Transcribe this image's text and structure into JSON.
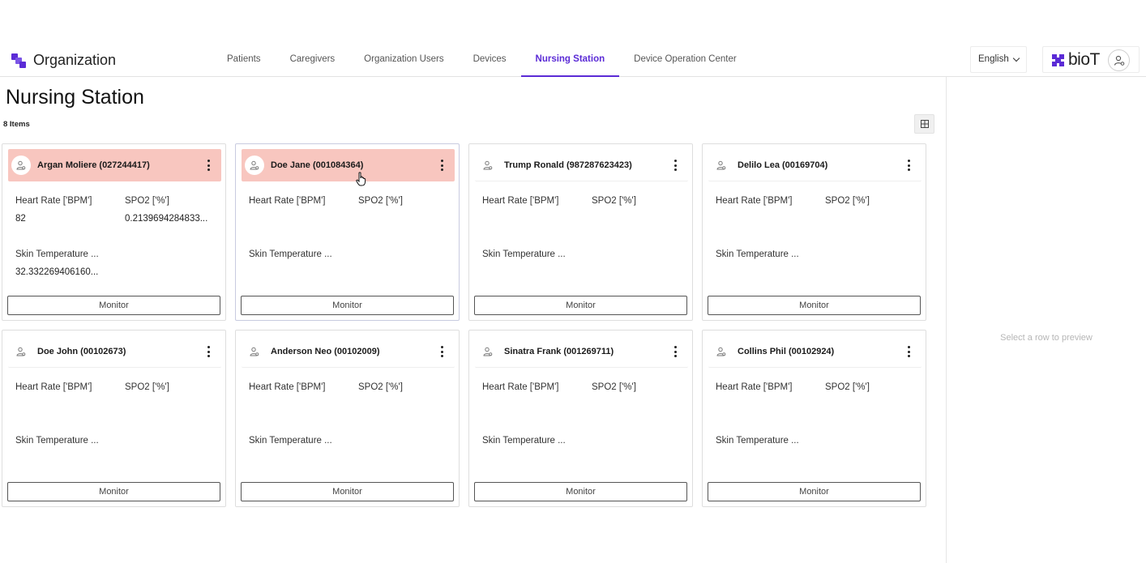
{
  "app": {
    "title": "Organization",
    "brand": "bioT"
  },
  "nav": {
    "tabs": [
      {
        "label": "Patients"
      },
      {
        "label": "Caregivers"
      },
      {
        "label": "Organization Users"
      },
      {
        "label": "Devices"
      },
      {
        "label": "Nursing Station",
        "active": true
      },
      {
        "label": "Device Operation Center"
      }
    ]
  },
  "language": {
    "selected": "English"
  },
  "page": {
    "title": "Nursing Station",
    "item_count": "8 Items"
  },
  "preview": {
    "empty_text": "Select a row to preview"
  },
  "colors": {
    "accent": "#5b2bd6",
    "alert_bg": "#f8c6bf"
  },
  "labels": {
    "heart_rate": "Heart Rate ['BPM']",
    "spo2": "SPO2 ['%']",
    "skin_temp": "Skin Temperature ...",
    "monitor": "Monitor"
  },
  "cards": [
    {
      "name": "Argan Moliere (027244417)",
      "alert": true,
      "heart_rate": "82",
      "spo2": "0.2139694284833...",
      "skin_temp": "32.332269406160..."
    },
    {
      "name": "Doe Jane (001084364)",
      "alert": true,
      "selected": true,
      "heart_rate": "",
      "spo2": "",
      "skin_temp": ""
    },
    {
      "name": "Trump Ronald (987287623423)",
      "alert": false,
      "heart_rate": "",
      "spo2": "",
      "skin_temp": ""
    },
    {
      "name": "Delilo Lea (00169704)",
      "alert": false,
      "heart_rate": "",
      "spo2": "",
      "skin_temp": ""
    },
    {
      "name": "Doe John (00102673)",
      "alert": false,
      "heart_rate": "",
      "spo2": "",
      "skin_temp": ""
    },
    {
      "name": "Anderson Neo (00102009)",
      "alert": false,
      "heart_rate": "",
      "spo2": "",
      "skin_temp": ""
    },
    {
      "name": "Sinatra Frank (001269711)",
      "alert": false,
      "heart_rate": "",
      "spo2": "",
      "skin_temp": ""
    },
    {
      "name": "Collins Phil (00102924)",
      "alert": false,
      "heart_rate": "",
      "spo2": "",
      "skin_temp": ""
    }
  ]
}
